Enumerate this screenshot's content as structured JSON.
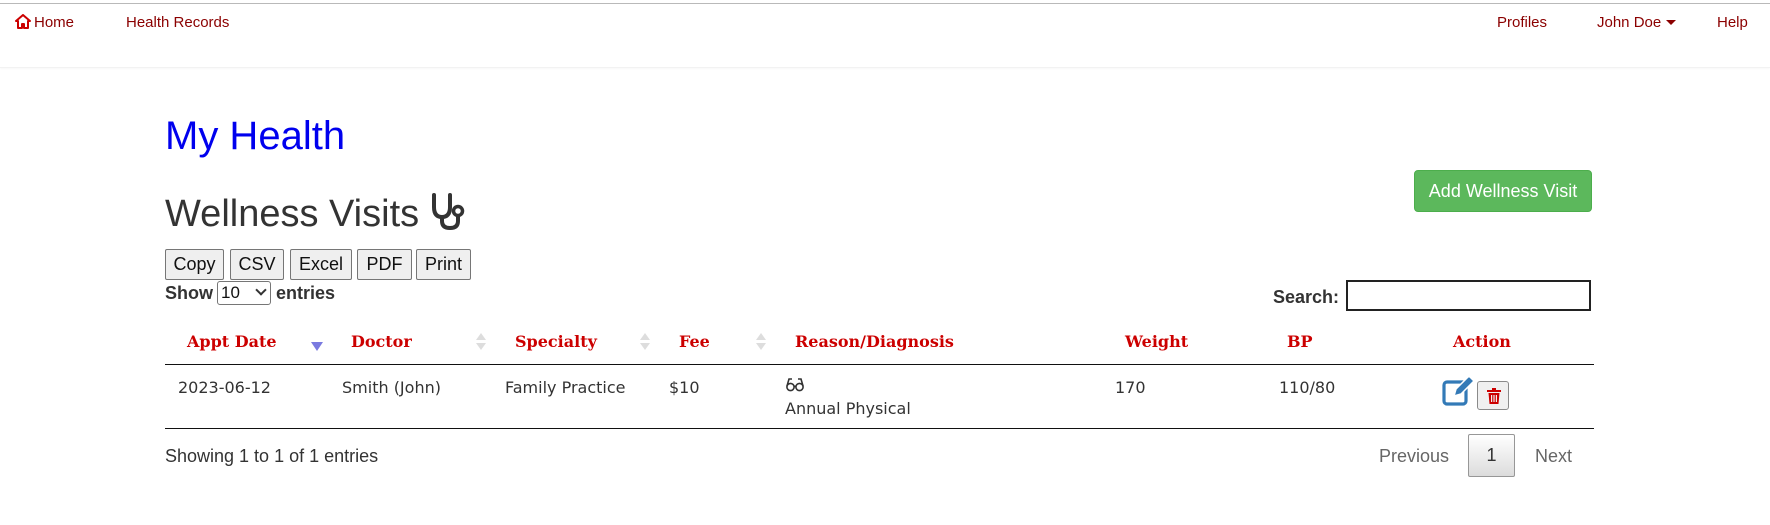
{
  "nav": {
    "home": "Home",
    "health_records": "Health Records",
    "profiles": "Profiles",
    "user": "John Doe",
    "help": "Help"
  },
  "page_title": "My Health",
  "section_title": "Wellness Visits",
  "add_button": "Add Wellness Visit",
  "export_buttons": [
    "Copy",
    "CSV",
    "Excel",
    "PDF",
    "Print"
  ],
  "length": {
    "show": "Show",
    "value": "10",
    "entries": "entries"
  },
  "search": {
    "label": "Search:",
    "value": ""
  },
  "table": {
    "headers": [
      "Appt Date",
      "Doctor",
      "Specialty",
      "Fee",
      "Reason/Diagnosis",
      "Weight",
      "BP",
      "Action"
    ],
    "rows": [
      {
        "appt_date": "2023-06-12",
        "doctor": "Smith (John)",
        "specialty": "Family Practice",
        "fee": "$10",
        "reason_icon": "glasses-icon",
        "reason": "Annual Physical",
        "weight": "170",
        "bp": "110/80"
      }
    ]
  },
  "info": "Showing 1 to 1 of 1 entries",
  "pagination": {
    "previous": "Previous",
    "current": "1",
    "next": "Next"
  },
  "colors": {
    "nav_link": "#8b0000",
    "page_title": "#0000ee",
    "header_text": "#cc0000",
    "add_button": "#5cb85c",
    "edit_icon": "#337ab7",
    "delete_icon": "#cc0000"
  }
}
